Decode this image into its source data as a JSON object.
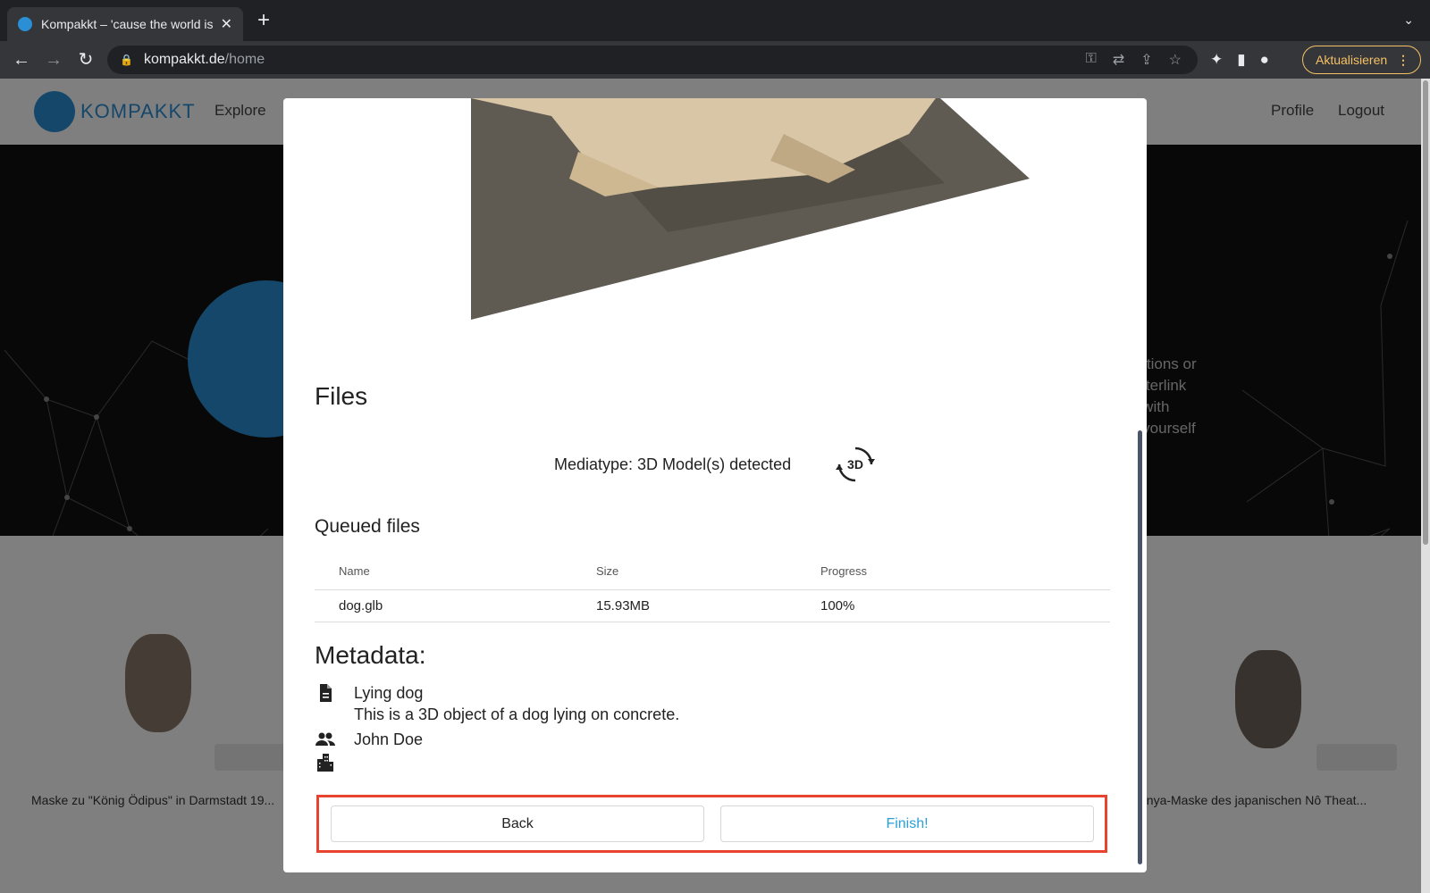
{
  "browser": {
    "tab_title": "Kompakkt – 'cause the world is",
    "tab_close": "✕",
    "new_tab": "+",
    "tab_menu": "⌄",
    "url_domain": "kompakkt.de",
    "url_path": "/home",
    "update_label": "Aktualisieren",
    "update_menu": "⋮"
  },
  "site": {
    "logo_text": "KOMPAKKT",
    "nav": {
      "explore": "Explore",
      "profile": "Profile",
      "logout": "Logout"
    },
    "hero_text": "riptions or\n interlink\ng with\ne yourself",
    "cards": [
      {
        "caption": "Maske zu \"König Ödipus\" in Darmstadt 19..."
      },
      {
        "caption": "nnya-Maske des japanischen Nô Theat..."
      }
    ]
  },
  "modal": {
    "files_title": "Files",
    "mediatype_text": "Mediatype: 3D Model(s) detected",
    "mediatype_icon_label": "3D",
    "queued_title": "Queued files",
    "table": {
      "headers": {
        "name": "Name",
        "size": "Size",
        "progress": "Progress"
      },
      "rows": [
        {
          "name": "dog.glb",
          "size": "15.93MB",
          "progress": "100%"
        }
      ]
    },
    "metadata_title": "Metadata:",
    "metadata": {
      "title": "Lying dog",
      "description": "This is a 3D object of a dog lying on concrete.",
      "person": "John Doe",
      "institution": ""
    },
    "buttons": {
      "back": "Back",
      "finish": "Finish!"
    }
  },
  "colors": {
    "accent": "#2b8fd6",
    "finish_text": "#2a9fd8",
    "highlight_outline": "#e8432e",
    "update_button": "#f5c164"
  }
}
